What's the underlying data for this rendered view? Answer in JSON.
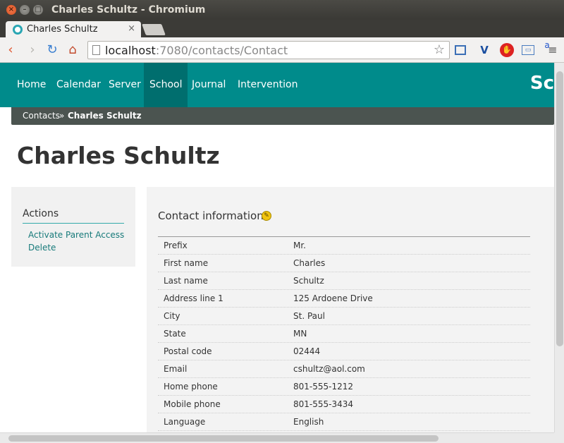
{
  "window": {
    "title": "Charles Schultz - Chromium"
  },
  "tab": {
    "title": "Charles Schultz",
    "close": "×"
  },
  "toolbar": {
    "url_host": "localhost",
    "url_rest": ":7080/contacts/Contact",
    "back": "‹",
    "forward": "›",
    "reload": "↻",
    "home": "⌂",
    "star": "☆",
    "menu": "≡",
    "ext5": "a"
  },
  "nav": {
    "items": [
      "Home",
      "Calendar",
      "Server",
      "School",
      "Journal",
      "Intervention"
    ],
    "active": "School",
    "brand": "Sc"
  },
  "breadcrumb": {
    "items": [
      "Contacts",
      "»",
      "Charles Schultz"
    ]
  },
  "page": {
    "title": "Charles Schultz"
  },
  "actions": {
    "heading": "Actions",
    "links": [
      "Activate Parent Access",
      "Delete"
    ]
  },
  "contact": {
    "heading": "Contact information",
    "edit_icon": "✎",
    "rows": [
      {
        "label": "Prefix",
        "value": "Mr."
      },
      {
        "label": "First name",
        "value": "Charles"
      },
      {
        "label": "Last name",
        "value": "Schultz"
      },
      {
        "label": "Address line 1",
        "value": "125 Ardoene Drive"
      },
      {
        "label": "City",
        "value": "St. Paul"
      },
      {
        "label": "State",
        "value": "MN"
      },
      {
        "label": "Postal code",
        "value": "02444"
      },
      {
        "label": "Email",
        "value": "cshultz@aol.com"
      },
      {
        "label": "Home phone",
        "value": "801-555-1212"
      },
      {
        "label": "Mobile phone",
        "value": "801-555-3434"
      },
      {
        "label": "Language",
        "value": "English"
      }
    ]
  },
  "colors": {
    "nav_bg": "#008b8b",
    "nav_active": "#006e6e",
    "crumb_bg": "#4b5450",
    "link": "#177a7a"
  }
}
